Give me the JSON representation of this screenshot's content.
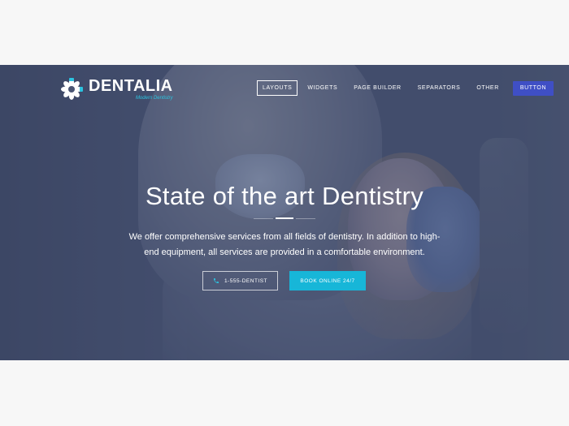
{
  "brand": {
    "name": "DENTALIA",
    "tagline": "Modern Dentistry",
    "icon": "tooth-flower-logo-icon",
    "accent_color": "#2cc4e0"
  },
  "nav": {
    "items": [
      {
        "label": "LAYOUTS",
        "active": true
      },
      {
        "label": "WIDGETS",
        "active": false
      },
      {
        "label": "PAGE BUILDER",
        "active": false
      },
      {
        "label": "SEPARATORS",
        "active": false
      },
      {
        "label": "OTHER",
        "active": false
      }
    ],
    "button_label": "BUTTON",
    "button_color": "#3f4fc5"
  },
  "hero": {
    "title": "State of the art Dentistry",
    "description": "We offer comprehensive services from all fields of dentistry. In addition to high-end equipment, all services are provided in a comfortable environment.",
    "phone_button": {
      "label": "1-555-DENTIST",
      "icon": "phone-icon"
    },
    "book_button": {
      "label": "BOOK ONLINE 24/7",
      "color": "#17b6d8"
    }
  }
}
